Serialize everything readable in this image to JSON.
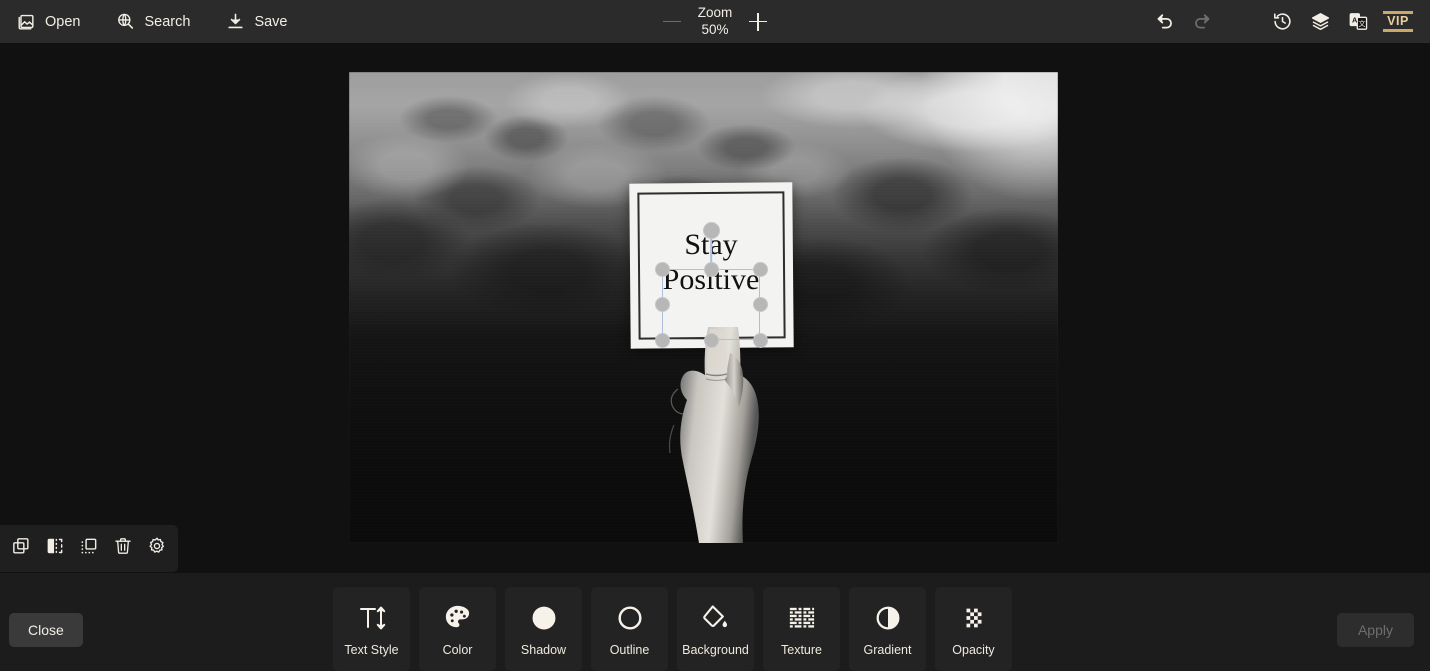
{
  "topbar": {
    "left_buttons": [
      {
        "label": "Open",
        "icon": "image-open-icon"
      },
      {
        "label": "Search",
        "icon": "globe-search-icon"
      },
      {
        "label": "Save",
        "icon": "download-save-icon"
      }
    ],
    "zoom": {
      "title": "Zoom",
      "value": "50%",
      "minus_label": "−",
      "plus_label": "+",
      "minus_enabled": false,
      "plus_enabled": true
    },
    "right_buttons": [
      {
        "name": "undo-icon",
        "label": "Undo",
        "enabled": true
      },
      {
        "name": "redo-icon",
        "label": "Redo",
        "enabled": false
      },
      {
        "name": "history-icon",
        "label": "History",
        "enabled": true
      },
      {
        "name": "layers-icon",
        "label": "Layers",
        "enabled": true
      },
      {
        "name": "translate-icon",
        "label": "Translate",
        "enabled": true
      }
    ],
    "vip": {
      "label": "VIP",
      "color": "#e8cf9d",
      "bar_color": "#c9a86a"
    }
  },
  "canvas": {
    "text_object": {
      "line1": "Stay",
      "line2": "Positive",
      "selected": true,
      "handle_color": "#b7b7b7",
      "selection_outline_color": "#aebde0"
    }
  },
  "object_toolbar": {
    "items": [
      {
        "name": "duplicate-icon",
        "label": "Duplicate"
      },
      {
        "name": "flip-icon",
        "label": "Flip"
      },
      {
        "name": "layer-icon",
        "label": "Arrange"
      },
      {
        "name": "delete-icon",
        "label": "Delete"
      },
      {
        "name": "settings-icon",
        "label": "Settings"
      }
    ]
  },
  "bottom": {
    "close_label": "Close",
    "apply_label": "Apply",
    "apply_enabled": false,
    "tools": [
      {
        "label": "Text Style",
        "icon": "text-size-icon"
      },
      {
        "label": "Color",
        "icon": "palette-icon"
      },
      {
        "label": "Shadow",
        "icon": "shadow-circle-icon"
      },
      {
        "label": "Outline",
        "icon": "outline-ring-icon"
      },
      {
        "label": "Background",
        "icon": "paint-bucket-icon"
      },
      {
        "label": "Texture",
        "icon": "texture-weave-icon"
      },
      {
        "label": "Gradient",
        "icon": "gradient-circle-icon"
      },
      {
        "label": "Opacity",
        "icon": "checkerboard-icon"
      }
    ]
  },
  "colors": {
    "topbar_bg": "#2b2b2b",
    "stage_bg": "#111111",
    "panel_bg": "#1c1c1c",
    "tool_bg": "#232323",
    "accent_gold": "#c9a86a",
    "text": "#f2eee6"
  }
}
